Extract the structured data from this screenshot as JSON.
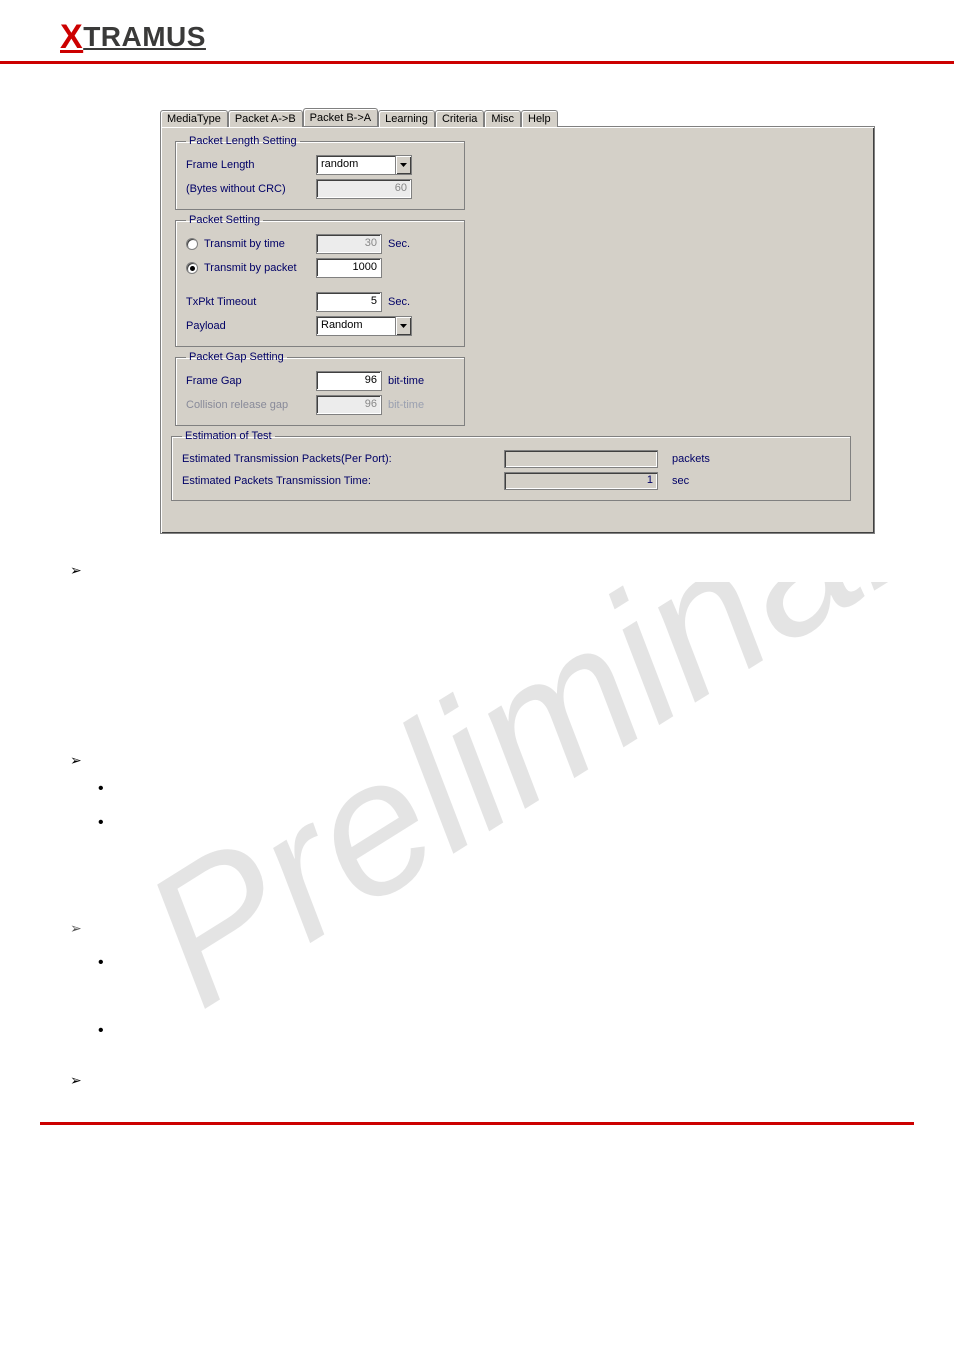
{
  "brand": {
    "x": "X",
    "rest": "TRAMUS"
  },
  "tabs": {
    "items": [
      {
        "label": "MediaType"
      },
      {
        "label": "Packet A->B"
      },
      {
        "label": "Packet B->A"
      },
      {
        "label": "Learning"
      },
      {
        "label": "Criteria"
      },
      {
        "label": "Misc"
      },
      {
        "label": "Help"
      }
    ],
    "active_index": 2
  },
  "packet_length": {
    "legend": "Packet Length Setting",
    "frame_length_label": "Frame Length",
    "frame_length_value": "random",
    "bytes_label": "(Bytes without CRC)",
    "bytes_value": "60"
  },
  "packet_setting": {
    "legend": "Packet Setting",
    "transmit_time_label": "Transmit by time",
    "transmit_time_value": "30",
    "transmit_time_unit": "Sec.",
    "transmit_packet_label": "Transmit by packet",
    "transmit_packet_value": "1000",
    "txpkt_timeout_label": "TxPkt Timeout",
    "txpkt_timeout_value": "5",
    "txpkt_timeout_unit": "Sec.",
    "payload_label": "Payload",
    "payload_value": "Random",
    "selected": "packet"
  },
  "packet_gap": {
    "legend": "Packet Gap Setting",
    "frame_gap_label": "Frame Gap",
    "frame_gap_value": "96",
    "frame_gap_unit": "bit-time",
    "collision_label": "Collision release gap",
    "collision_value": "96",
    "collision_unit": "bit-time"
  },
  "estimation": {
    "legend": "Estimation of Test",
    "packets_label": "Estimated Transmission Packets(Per Port):",
    "packets_value": "",
    "packets_unit": "packets",
    "time_label": "Estimated Packets Transmission Time:",
    "time_value": "1",
    "time_unit": "sec"
  },
  "colors": {
    "red": "#cc0000",
    "legend": "#000066",
    "panel": "#d4d0c8"
  }
}
